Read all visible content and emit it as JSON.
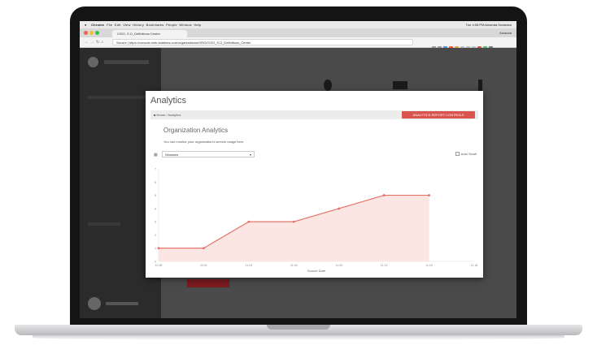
{
  "browser": {
    "menubar": {
      "app": "Chrome",
      "menus": [
        "File",
        "Edit",
        "View",
        "History",
        "Bookmarks",
        "People",
        "Window",
        "Help"
      ],
      "status": "Tue 4:08 PM   Amanda Snowdon"
    },
    "tab_title": "CISO, S.O_Definitions Center",
    "user_name": "Amanda",
    "url": "Secure | https://console-web.salafons.com/organizations/ORG/CISO_S.O_Definitions_Center"
  },
  "modal": {
    "title": "Analytics",
    "breadcrumb": "Home / Analytics",
    "action_button": "ANALYTICS REPORT CONTROLS",
    "section_title": "Organization Analytics",
    "section_description": "You can monitor your organization's service usage here.",
    "metric_select": "Sessions",
    "auto_scroll_label": "Auto Scroll"
  },
  "chart_data": {
    "type": "line",
    "x": [
      "10.28",
      "10.31",
      "11.03",
      "11.06",
      "11.09",
      "11.12",
      "11.15",
      "11.18"
    ],
    "series": [
      {
        "values": [
          1,
          1,
          3,
          3,
          4,
          5,
          5,
          null
        ]
      }
    ],
    "yticks": [
      0,
      1,
      2,
      3,
      4,
      5,
      6,
      7
    ],
    "ylim": [
      0,
      7
    ],
    "xlabel": "Source Date",
    "ylabel": "",
    "grid": false,
    "colors": {
      "line": "#e57368",
      "fill": "#fbe6e3"
    }
  },
  "colors": {
    "accent_red": "#d9534f",
    "overlay_dark": "#3a3a3a"
  }
}
